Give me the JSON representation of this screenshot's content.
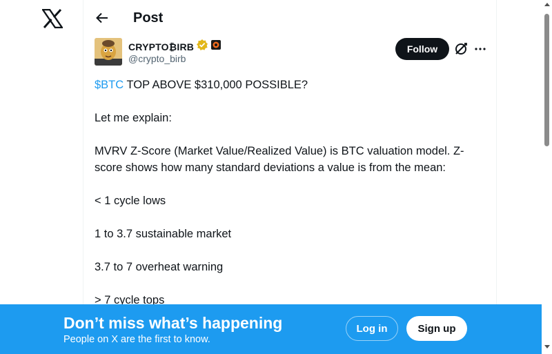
{
  "nav": {
    "logo_icon": "x-logo-icon"
  },
  "header": {
    "title": "Post",
    "back_icon": "arrow-left-icon"
  },
  "author": {
    "display_name": "CRYPTO₿IRB",
    "handle": "@crypto_birb",
    "verified_badge": "gold-verified-icon",
    "affiliate_badge": "affiliate-badge-icon"
  },
  "actions": {
    "follow_label": "Follow",
    "grok_icon": "grok-icon",
    "more_icon": "more-dots-icon"
  },
  "post": {
    "cashtag": "$BTC",
    "headline": " TOP ABOVE $310,000 POSSIBLE?",
    "paragraphs": [
      "Let me explain:",
      "MVRV Z-Score (Market Value/Realized Value) is BTC valuation model. Z-score shows how many standard deviations a value is from the mean:",
      "< 1 cycle lows",
      "1 to 3.7 sustainable market",
      "3.7 to 7 overheat warning",
      "> 7 cycle tops"
    ]
  },
  "banner": {
    "title": "Don’t miss what’s happening",
    "subtitle": "People on X are the first to know.",
    "login_label": "Log in",
    "signup_label": "Sign up"
  },
  "colors": {
    "accent": "#1d9bf0",
    "text": "#0f1419",
    "secondary_text": "#536471",
    "follow_bg": "#0f1419"
  }
}
